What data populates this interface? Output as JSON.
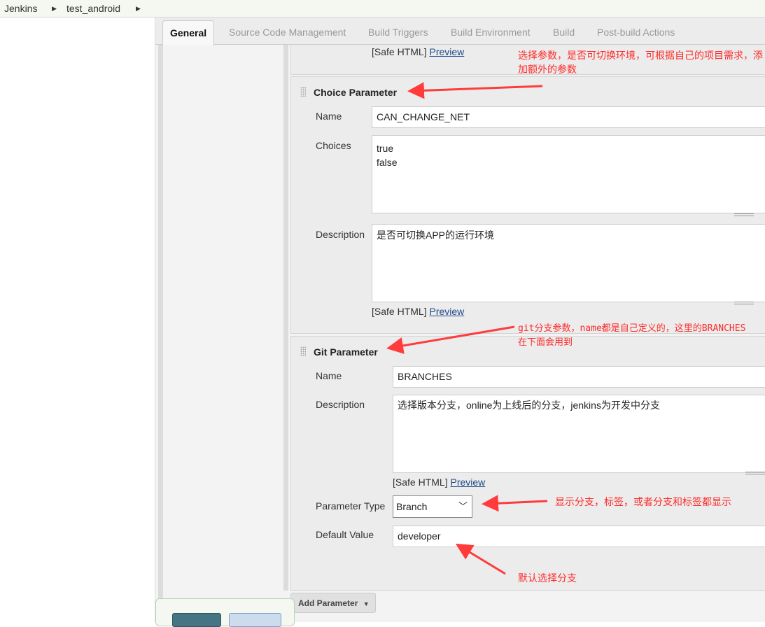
{
  "breadcrumb": [
    "Jenkins",
    "test_android"
  ],
  "tabs": [
    "General",
    "Source Code Management",
    "Build Triggers",
    "Build Environment",
    "Build",
    "Post-build Actions"
  ],
  "top_section": {
    "safe_html": "[Safe HTML]",
    "preview": "Preview"
  },
  "choice": {
    "title": "Choice Parameter",
    "name_label": "Name",
    "name_value": "CAN_CHANGE_NET",
    "choices_label": "Choices",
    "choices_value": "true\nfalse",
    "desc_label": "Description",
    "desc_value": "是否可切换APP的运行环境",
    "safe_html": "[Safe HTML]",
    "preview": "Preview"
  },
  "git": {
    "title": "Git Parameter",
    "name_label": "Name",
    "name_value": "BRANCHES",
    "desc_label": "Description",
    "desc_value": "选择版本分支，online为上线后的分支，jenkins为开发中分支",
    "safe_html": "[Safe HTML]",
    "preview": "Preview",
    "type_label": "Parameter Type",
    "type_value": "Branch",
    "default_label": "Default Value",
    "default_value": "developer"
  },
  "add_parameter": "Add Parameter",
  "annotations": {
    "a1": "选择参数，是否可切换环境，可根据自己的项目需求，添加额外的参数",
    "a2": "git分支参数，name都是自己定义的，这里的BRANCHES在下面会用到",
    "a3": "显示分支，标签，或者分支和标签都显示",
    "a4": "默认选择分支"
  },
  "colors": {
    "annotation": "#ff2a2a",
    "link": "#204a87",
    "save_button": "#457585",
    "apply_button": "#cddcec"
  }
}
